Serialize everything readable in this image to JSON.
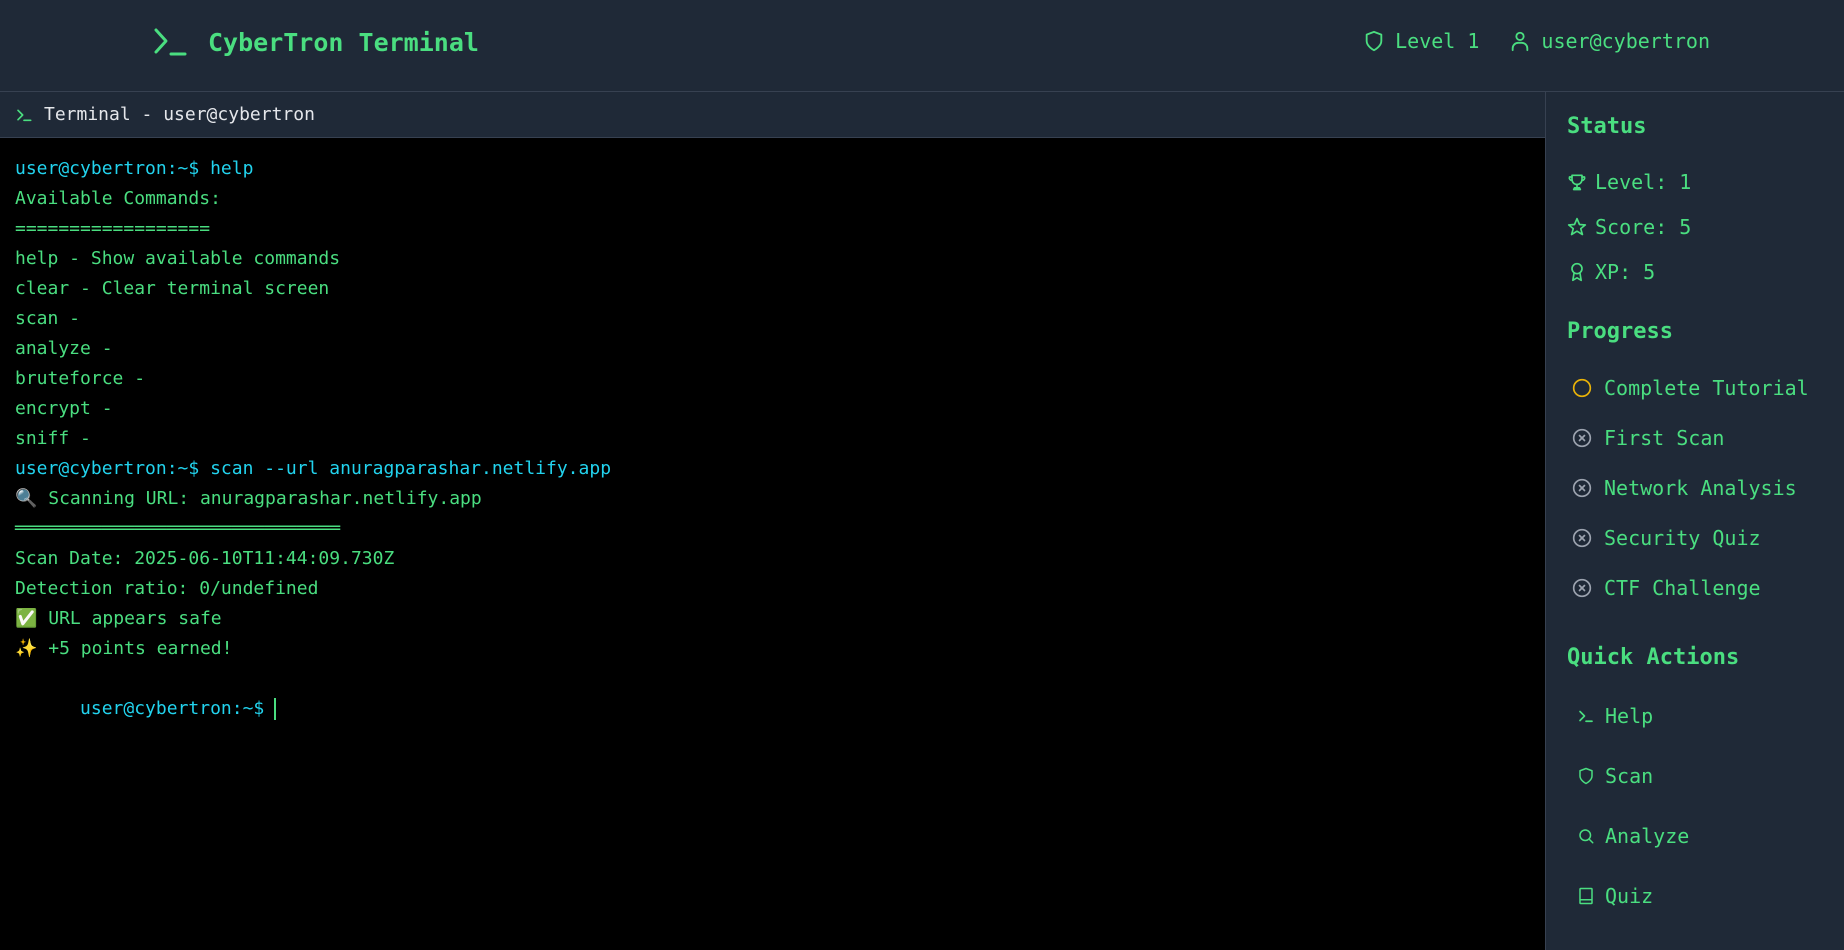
{
  "header": {
    "title": "CyberTron Terminal",
    "level": "Level 1",
    "user": "user@cybertron"
  },
  "terminal": {
    "tab_title": "Terminal - user@cybertron",
    "lines": [
      {
        "text": "user@cybertron:~$ help",
        "kind": "cmd"
      },
      {
        "text": "Available Commands:",
        "kind": "out"
      },
      {
        "text": "==================",
        "kind": "out"
      },
      {
        "text": "help - Show available commands",
        "kind": "out"
      },
      {
        "text": "clear - Clear terminal screen",
        "kind": "out"
      },
      {
        "text": "scan -",
        "kind": "out"
      },
      {
        "text": "analyze -",
        "kind": "out"
      },
      {
        "text": "bruteforce -",
        "kind": "out"
      },
      {
        "text": "encrypt -",
        "kind": "out"
      },
      {
        "text": "sniff -",
        "kind": "out"
      },
      {
        "text": "user@cybertron:~$ scan --url anuragparashar.netlify.app",
        "kind": "cmd"
      },
      {
        "text": "🔍 Scanning URL: anuragparashar.netlify.app",
        "kind": "out"
      },
      {
        "text": "══════════════════════════════",
        "kind": "out"
      },
      {
        "text": "Scan Date: 2025-06-10T11:44:09.730Z",
        "kind": "out"
      },
      {
        "text": "Detection ratio: 0/undefined",
        "kind": "out"
      },
      {
        "text": "✅ URL appears safe",
        "kind": "out"
      },
      {
        "text": "✨ +5 points earned!",
        "kind": "out"
      }
    ],
    "prompt": "user@cybertron:~$"
  },
  "sidebar": {
    "status_title": "Status",
    "status": [
      {
        "label": "Level: 1",
        "icon": "trophy-icon"
      },
      {
        "label": "Score: 5",
        "icon": "star-icon"
      },
      {
        "label": "XP: 5",
        "icon": "award-icon"
      }
    ],
    "progress_title": "Progress",
    "progress": [
      {
        "label": "Complete Tutorial",
        "state": "in-progress",
        "icon": "circle-icon",
        "color": "#eab308"
      },
      {
        "label": "First Scan",
        "state": "locked",
        "icon": "x-circle-icon",
        "color": "#9ca3af"
      },
      {
        "label": "Network Analysis",
        "state": "locked",
        "icon": "x-circle-icon",
        "color": "#9ca3af"
      },
      {
        "label": "Security Quiz",
        "state": "locked",
        "icon": "x-circle-icon",
        "color": "#9ca3af"
      },
      {
        "label": "CTF Challenge",
        "state": "locked",
        "icon": "x-circle-icon",
        "color": "#9ca3af"
      }
    ],
    "quick_actions_title": "Quick Actions",
    "quick_actions": [
      {
        "label": "Help",
        "icon": "terminal-icon"
      },
      {
        "label": "Scan",
        "icon": "shield-icon"
      },
      {
        "label": "Analyze",
        "icon": "search-icon"
      },
      {
        "label": "Quiz",
        "icon": "book-icon"
      }
    ]
  },
  "colors": {
    "accent": "#4ade80",
    "prompt": "#22d3ee",
    "panel": "#1f2937",
    "pending": "#eab308",
    "locked": "#9ca3af"
  }
}
